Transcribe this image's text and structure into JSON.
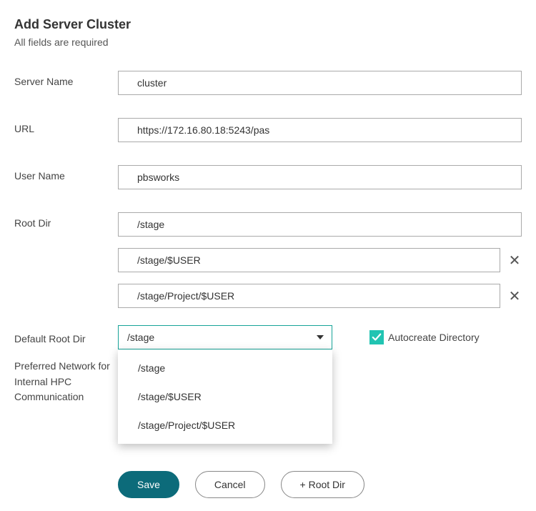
{
  "header": {
    "title": "Add Server Cluster",
    "subtitle": "All fields are required"
  },
  "labels": {
    "server_name": "Server Name",
    "url": "URL",
    "user_name": "User Name",
    "root_dir": "Root Dir",
    "default_root_dir": "Default Root Dir",
    "preferred_network": "Preferred Network for Internal HPC Communication",
    "autocreate": "Autocreate Directory"
  },
  "fields": {
    "server_name": "cluster",
    "url": "https://172.16.80.18:5243/pas",
    "user_name": "pbsworks",
    "root_dir": "/stage",
    "extra_dirs": [
      "/stage/$USER",
      "/stage/Project/$USER"
    ],
    "default_root_dir_selected": "/stage",
    "default_root_dir_options": [
      "/stage",
      "/stage/$USER",
      "/stage/Project/$USER"
    ],
    "autocreate_checked": true
  },
  "buttons": {
    "save": "Save",
    "cancel": "Cancel",
    "add_root_dir": "+ Root Dir"
  }
}
